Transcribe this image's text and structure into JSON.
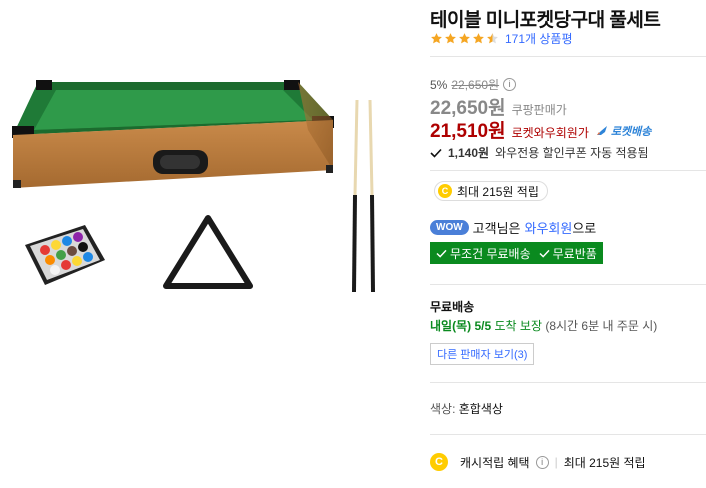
{
  "product": {
    "title": "테이블 미니포켓당구대 풀세트",
    "rating": 4.5,
    "review_count_text": "171개 상품평"
  },
  "pricing": {
    "discount_rate": "5%",
    "original_price": "22,650원",
    "coupang_price": "22,650원",
    "coupang_price_label": "쿠팡판매가",
    "wow_price": "21,510원",
    "wow_price_label": "로켓와우회원가",
    "rocket_badge": "로켓배송",
    "coupon_amount": "1,140원",
    "coupon_text": "와우전용 할인쿠폰 자동 적용됨"
  },
  "reward": {
    "coin_label": "C",
    "text": "최대 215원 적립"
  },
  "wow": {
    "badge": "WOW",
    "prefix": "고객님은",
    "member": "와우회원",
    "suffix": "으로",
    "benefit_1": "무조건 무료배송",
    "benefit_2": "무료반품"
  },
  "shipping": {
    "title": "무료배송",
    "date": "내일(목) 5/5",
    "guarantee": "도착 보장",
    "condition": "(8시간 6분 내 주문 시)",
    "other_sellers": "다른 판매자 보기(3)"
  },
  "option": {
    "key": "색상:",
    "value": "혼합색상"
  },
  "cash": {
    "coin_label": "C",
    "label": "캐시적립 혜택",
    "separator": "|",
    "value": "최대 215원 적립"
  },
  "colors": {
    "wow_price": "#ae0000",
    "link_blue": "#346aff",
    "benefit_green": "#0a8a1f",
    "star": "#f5a623",
    "coin": "#ffcc00"
  },
  "icons": {
    "info": "info-icon",
    "check": "check-icon",
    "rocket": "rocket-icon",
    "star": "star-icon"
  }
}
